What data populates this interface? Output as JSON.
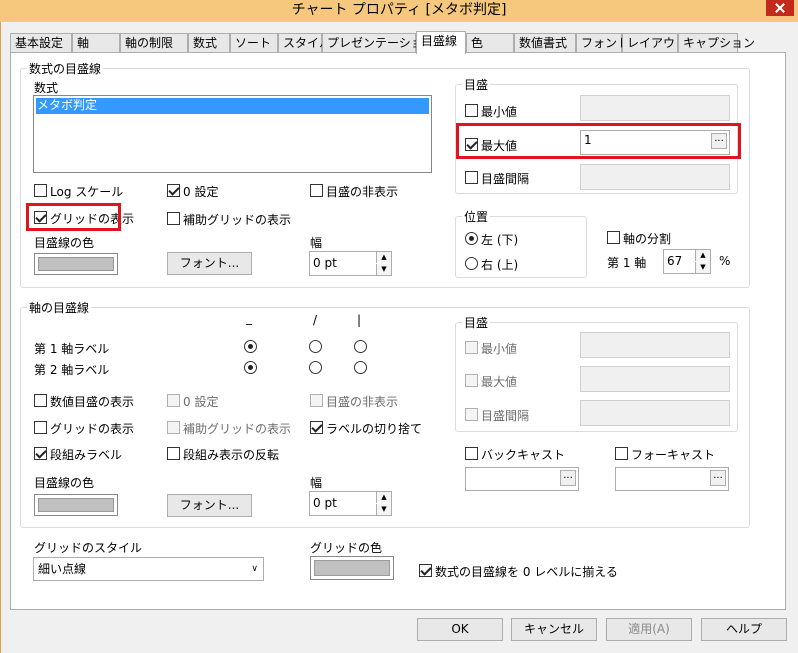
{
  "window": {
    "title": "チャート プロパティ [メタボ判定]"
  },
  "tabs": [
    "基本設定",
    "軸",
    "軸の制限",
    "数式",
    "ソート",
    "スタイル",
    "プレゼンテーション",
    "目盛線",
    "色",
    "数値書式",
    "フォント",
    "レイアウト",
    "キャプション"
  ],
  "active_tab": "目盛線",
  "expr_grid": {
    "legend": "数式の目盛線",
    "expr_label": "数式",
    "expr_items": [
      "メタボ判定"
    ],
    "log_scale": "Log スケール",
    "zero_setting": "0 設定",
    "hide_gridlines": "目盛の非表示",
    "show_grid": "グリッドの表示",
    "show_minor_grid": "補助グリッドの表示",
    "gridline_color": "目盛線の色",
    "font_button": "フォント...",
    "width_label": "幅",
    "width_value": "0 pt",
    "scale": {
      "legend": "目盛",
      "min": "最小値",
      "max": "最大値",
      "max_value": "1",
      "interval": "目盛間隔"
    },
    "position": {
      "legend": "位置",
      "left": "左 (下)",
      "right": "右 (上)"
    },
    "axis_split": "軸の分割",
    "first_axis": "第 1 軸",
    "split_value": "67",
    "percent": "%"
  },
  "axis_grid": {
    "legend": "軸の目盛線",
    "col_marks": [
      "_",
      "/",
      "|"
    ],
    "first_axis_label": "第 1 軸ラベル",
    "second_axis_label": "第 2 軸ラベル",
    "show_numeric": "数値目盛の表示",
    "zero_setting": "0 設定",
    "hide_gridlines": "目盛の非表示",
    "show_grid": "グリッドの表示",
    "show_minor_grid": "補助グリッドの表示",
    "truncate_labels": "ラベルの切り捨て",
    "stagger_labels": "段組みラベル",
    "reverse_stagger": "段組み表示の反転",
    "gridline_color": "目盛線の色",
    "font_button": "フォント...",
    "width_label": "幅",
    "width_value": "0 pt",
    "scale": {
      "legend": "目盛",
      "min": "最小値",
      "max": "最大値",
      "interval": "目盛間隔"
    },
    "backcast": "バックキャスト",
    "forecast": "フォーキャスト"
  },
  "grid_style": {
    "label": "グリッドのスタイル",
    "value": "細い点線"
  },
  "grid_color_label": "グリッドの色",
  "align_zero": "数式の目盛線を 0 レベルに揃える",
  "buttons": {
    "ok": "OK",
    "cancel": "キャンセル",
    "apply": "適用(A)",
    "help": "ヘルプ"
  }
}
